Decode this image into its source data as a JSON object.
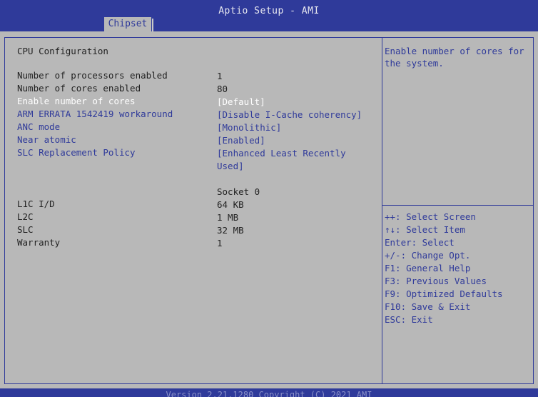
{
  "header": {
    "title": "Aptio Setup - AMI",
    "tabs": [
      {
        "label": "Chipset"
      }
    ]
  },
  "main": {
    "section_title": "CPU Configuration",
    "rows": [
      {
        "label": "Number of processors enabled",
        "value": "1"
      },
      {
        "label": "Number of cores enabled",
        "value": "80"
      },
      {
        "label": "Enable number of cores",
        "value": "[Default]"
      },
      {
        "label": "ARM ERRATA 1542419 workaround",
        "value": "[Disable I-Cache coherency]"
      },
      {
        "label": "ANC mode",
        "value": "[Monolithic]"
      },
      {
        "label": "Near atomic",
        "value": "[Enabled]"
      },
      {
        "label": "SLC Replacement Policy",
        "value": "[Enhanced Least Recently Used]"
      }
    ],
    "socket_header": "Socket 0",
    "socket_rows": [
      {
        "label": "L1C I/D",
        "value": "64 KB"
      },
      {
        "label": "L2C",
        "value": "1 MB"
      },
      {
        "label": "SLC",
        "value": "32 MB"
      },
      {
        "label": "Warranty",
        "value": "1"
      }
    ]
  },
  "help": {
    "text": "Enable number of cores for the system."
  },
  "keys": [
    "++: Select Screen",
    "↑↓: Select Item",
    "Enter: Select",
    "+/-: Change Opt.",
    "F1: General Help",
    "F3: Previous Values",
    "F9: Optimized Defaults",
    "F10: Save & Exit",
    "ESC: Exit"
  ],
  "footer": {
    "text": "Version 2.21.1280 Copyright (C) 2021 AMI"
  },
  "colors": {
    "background": "#b8b8b8",
    "bar": "#2f3a9a",
    "option_text": "#2f3a9a",
    "selected_text": "#ffffff"
  }
}
